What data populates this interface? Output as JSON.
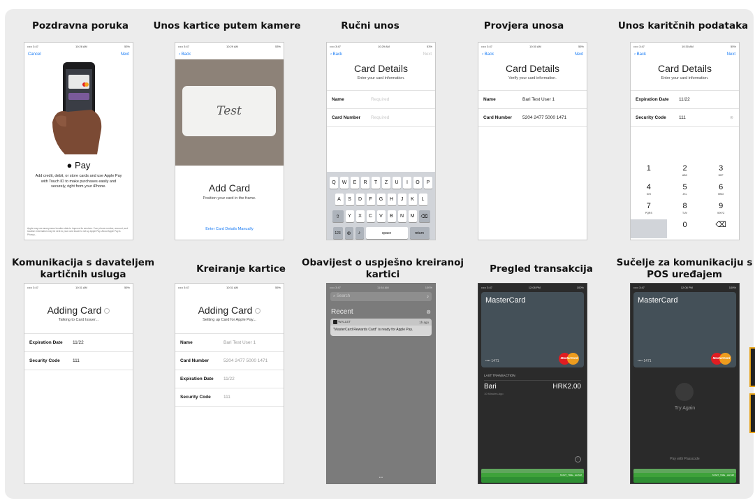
{
  "captions": {
    "c1": "Pozdravna poruka",
    "c2": "Unos kartice putem kamere",
    "c3": "Ručni unos",
    "c4": "Provjera unosa",
    "c5": "Unos karitčnih podataka",
    "c6a": "Komunikacija s davateljem",
    "c6b": "kartičnih usluga",
    "c7": "Kreiranje kartice",
    "c8a": "Obavijest o uspješno kreiranoj",
    "c8b": "kartici",
    "c9": "Pregled transakcija",
    "c10a": "Sučelje za komunikaciju s",
    "c10b": "POS uređajem"
  },
  "status": {
    "carrier": "••••• 3:47",
    "t1": "10:28 AM",
    "t2": "10:29 AM",
    "t3": "10:30 AM",
    "t4": "10:31 AM",
    "t5": "11:54 AM",
    "t6": "12:08 PM",
    "batt": "53%",
    "batt2": "55%",
    "batt3": "100%"
  },
  "s1": {
    "cancel": "Cancel",
    "next": "Next",
    "pay": "Pay",
    "desc": "Add credit, debit, or store cards and use Apple Pay with Touch ID to make purchases easily and securely, right from your iPhone.",
    "fine": "Apple may use anonymous location data to improve its services. Your phone number, account, and location information may be sent to your card issuer to set up Apple Pay. About Apple Pay & Privacy..."
  },
  "s2": {
    "back": "Back",
    "test": "Test",
    "title": "Add Card",
    "sub": "Position your card in the frame.",
    "manual": "Enter Card Details Manually"
  },
  "s3": {
    "back": "Back",
    "next": "Next",
    "title": "Card Details",
    "sub": "Enter your card information.",
    "name_l": "Name",
    "name_v": "Required",
    "num_l": "Card Number",
    "num_v": "Required",
    "row1": [
      "Q",
      "W",
      "E",
      "R",
      "T",
      "Z",
      "U",
      "I",
      "O",
      "P"
    ],
    "row2": [
      "A",
      "S",
      "D",
      "F",
      "G",
      "H",
      "J",
      "K",
      "L"
    ],
    "row3": [
      "Y",
      "X",
      "C",
      "V",
      "B",
      "N",
      "M"
    ],
    "k123": "123",
    "space": "space",
    "ret": "return"
  },
  "s4": {
    "back": "Back",
    "next": "Next",
    "title": "Card Details",
    "sub": "Verify your card information.",
    "name_l": "Name",
    "name_v": "Bari Test User 1",
    "num_l": "Card Number",
    "num_v": "5204 2477 5000 1471"
  },
  "s5": {
    "back": "Back",
    "next": "Next",
    "title": "Card Details",
    "sub": "Enter your card information.",
    "exp_l": "Expiration Date",
    "exp_v": "11/22",
    "sec_l": "Security Code",
    "sec_v": "111",
    "keys": [
      {
        "n": "1",
        "s": ""
      },
      {
        "n": "2",
        "s": "ABC"
      },
      {
        "n": "3",
        "s": "DEF"
      },
      {
        "n": "4",
        "s": "GHI"
      },
      {
        "n": "5",
        "s": "JKL"
      },
      {
        "n": "6",
        "s": "MNO"
      },
      {
        "n": "7",
        "s": "PQRS"
      },
      {
        "n": "8",
        "s": "TUV"
      },
      {
        "n": "9",
        "s": "WXYZ"
      },
      {
        "n": "",
        "s": ""
      },
      {
        "n": "0",
        "s": ""
      },
      {
        "n": "⌫",
        "s": ""
      }
    ]
  },
  "s6": {
    "title": "Adding Card",
    "sub": "Talking to Card Issuer...",
    "exp_l": "Expiration Date",
    "exp_v": "11/22",
    "sec_l": "Security Code",
    "sec_v": "111"
  },
  "s7": {
    "title": "Adding Card",
    "sub": "Setting up Card for Apple Pay...",
    "name_l": "Name",
    "name_v": "Bari Test User 1",
    "num_l": "Card Number",
    "num_v": "5204 2477 5000 1471",
    "exp_l": "Expiration Date",
    "exp_v": "11/22",
    "sec_l": "Security Code",
    "sec_v": "111"
  },
  "s8": {
    "search": "Search",
    "recent": "Recent",
    "app": "WALLET",
    "ago": "1h ago",
    "msg": "\"MasterCard Rewards Card\" is ready for Apple Pay."
  },
  "s9": {
    "card": "MasterCard",
    "digits": "•••• 1471",
    "mc": "MasterCard",
    "last": "LAST TRANSACTION",
    "merchant": "Bari",
    "amount": "HRK2.00",
    "when": "10 Minutes Ago",
    "strip": "START_TIME - HH:MM"
  },
  "s10": {
    "card": "MasterCard",
    "digits": "•••• 1471",
    "mc": "MasterCard",
    "retry": "Try Again",
    "passcode": "Pay with Passcode",
    "strip": "START_TIME - HH:MM"
  },
  "colors": {
    "ios_blue": "#1a7cf5",
    "board": "#ececec",
    "wallet_bg": "#2b2b2b",
    "mc_red": "#e01d22",
    "mc_orange": "#f7a01b"
  }
}
